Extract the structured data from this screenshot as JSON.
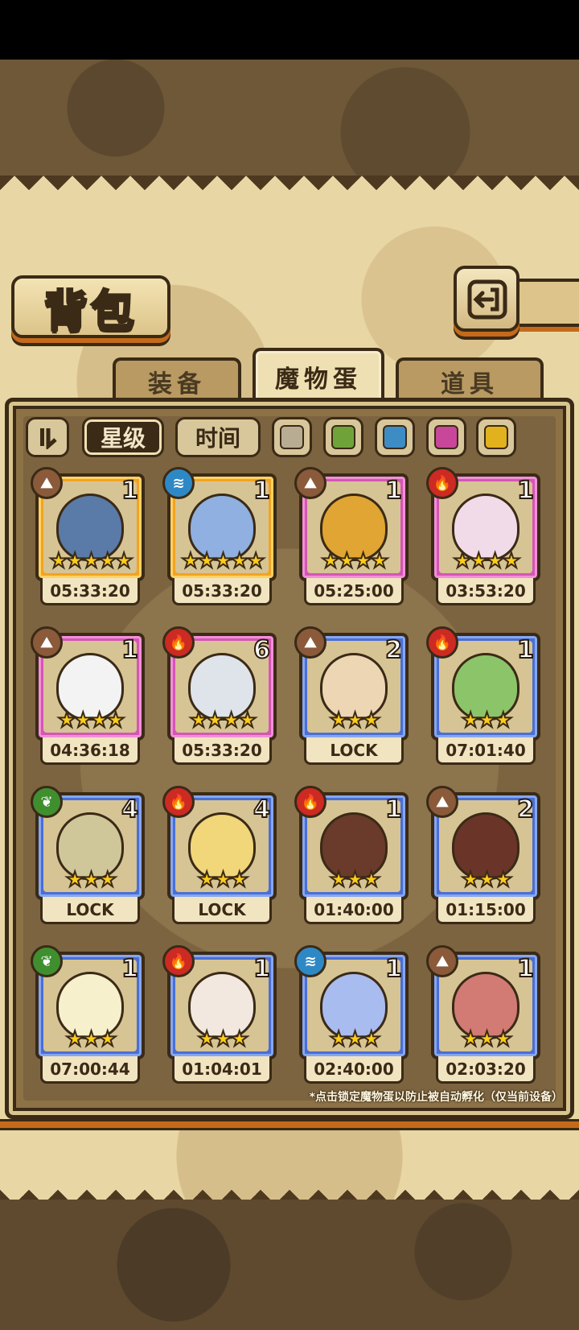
{
  "title": "背包",
  "tabs": [
    {
      "label": "装备",
      "active": false
    },
    {
      "label": "魔物蛋",
      "active": true
    },
    {
      "label": "道具",
      "active": false
    }
  ],
  "filters": {
    "sort_icon": "sort-toggle-icon",
    "star_label": "星级",
    "time_label": "时间",
    "colors": [
      "#b8ad92",
      "#6fa33a",
      "#3d8cc4",
      "#c8479a",
      "#e2b21e"
    ]
  },
  "eggs": [
    {
      "element": "earth",
      "count": "1",
      "stars": "★★★★★",
      "time": "05:33:20",
      "frame": "orange",
      "art": "hammer-icon"
    },
    {
      "element": "water",
      "count": "1",
      "stars": "★★★★★",
      "time": "05:33:20",
      "frame": "orange",
      "art": "sword-icon"
    },
    {
      "element": "earth",
      "count": "1",
      "stars": "★★★★",
      "time": "05:25:00",
      "frame": "pink",
      "art": "furry-egg-icon"
    },
    {
      "element": "fire",
      "count": "1",
      "stars": "★★★★",
      "time": "03:53:20",
      "frame": "pink",
      "art": "winged-egg-icon"
    },
    {
      "element": "earth",
      "count": "1",
      "stars": "★★★★",
      "time": "04:36:18",
      "frame": "pink",
      "art": "bandaged-egg-icon"
    },
    {
      "element": "fire",
      "count": "6",
      "stars": "★★★★",
      "time": "05:33:20",
      "frame": "pink",
      "art": "dagger-icon"
    },
    {
      "element": "earth",
      "count": "2",
      "stars": "★★★",
      "time": "LOCK",
      "frame": "blue",
      "art": "ghost-egg-icon"
    },
    {
      "element": "fire",
      "count": "1",
      "stars": "★★★",
      "time": "07:01:40",
      "frame": "blue",
      "art": "cactus-egg-icon"
    },
    {
      "element": "wood",
      "count": "4",
      "stars": "★★★",
      "time": "LOCK",
      "frame": "blue",
      "art": "seed-egg-icon"
    },
    {
      "element": "fire",
      "count": "4",
      "stars": "★★★",
      "time": "LOCK",
      "frame": "blue",
      "art": "sun-egg-icon"
    },
    {
      "element": "fire",
      "count": "1",
      "stars": "★★★",
      "time": "01:40:00",
      "frame": "blue",
      "art": "flame-claw-icon"
    },
    {
      "element": "earth",
      "count": "2",
      "stars": "★★★",
      "time": "01:15:00",
      "frame": "blue",
      "art": "choco-egg-icon"
    },
    {
      "element": "wood",
      "count": "1",
      "stars": "★★★",
      "time": "07:00:44",
      "frame": "blue",
      "art": "lotus-egg-icon"
    },
    {
      "element": "fire",
      "count": "1",
      "stars": "★★★",
      "time": "01:04:01",
      "frame": "blue",
      "art": "fire-egg-icon"
    },
    {
      "element": "water",
      "count": "1",
      "stars": "★★★",
      "time": "02:40:00",
      "frame": "blue",
      "art": "crystal-egg-icon"
    },
    {
      "element": "earth",
      "count": "1",
      "stars": "★★★",
      "time": "02:03:20",
      "frame": "blue",
      "art": "cat-egg-icon"
    }
  ],
  "element_glyphs": {
    "earth": "⛰",
    "water": "≋",
    "fire": "🔥",
    "wood": "❦"
  },
  "note": "*点击锁定魔物蛋以防止被自动孵化（仅当前设备）"
}
